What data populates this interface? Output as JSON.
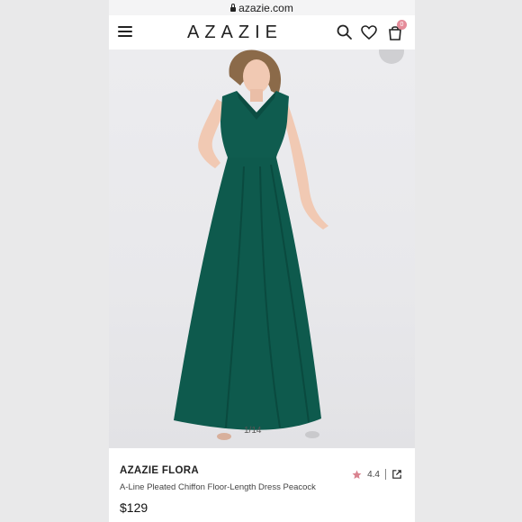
{
  "browser": {
    "url": "azazie.com"
  },
  "header": {
    "brand": "AZAZIE",
    "cart_count": "0",
    "menu_icon": "hamburger-menu-icon",
    "search_icon": "search-icon",
    "wishlist_icon": "heart-icon",
    "cart_icon": "shopping-bag-icon"
  },
  "gallery": {
    "counter": "1/14"
  },
  "product": {
    "brand_name": "AZAZIE FLORA",
    "title": "A-Line Pleated Chiffon Floor-Length Dress Peacock",
    "price": "$129",
    "rating": "4.4",
    "rating_icon": "star-icon",
    "share_icon": "external-link-icon"
  },
  "colors": {
    "dress": "#0e5a4d",
    "rating_star": "#d9838f",
    "badge": "#e58c9a"
  }
}
